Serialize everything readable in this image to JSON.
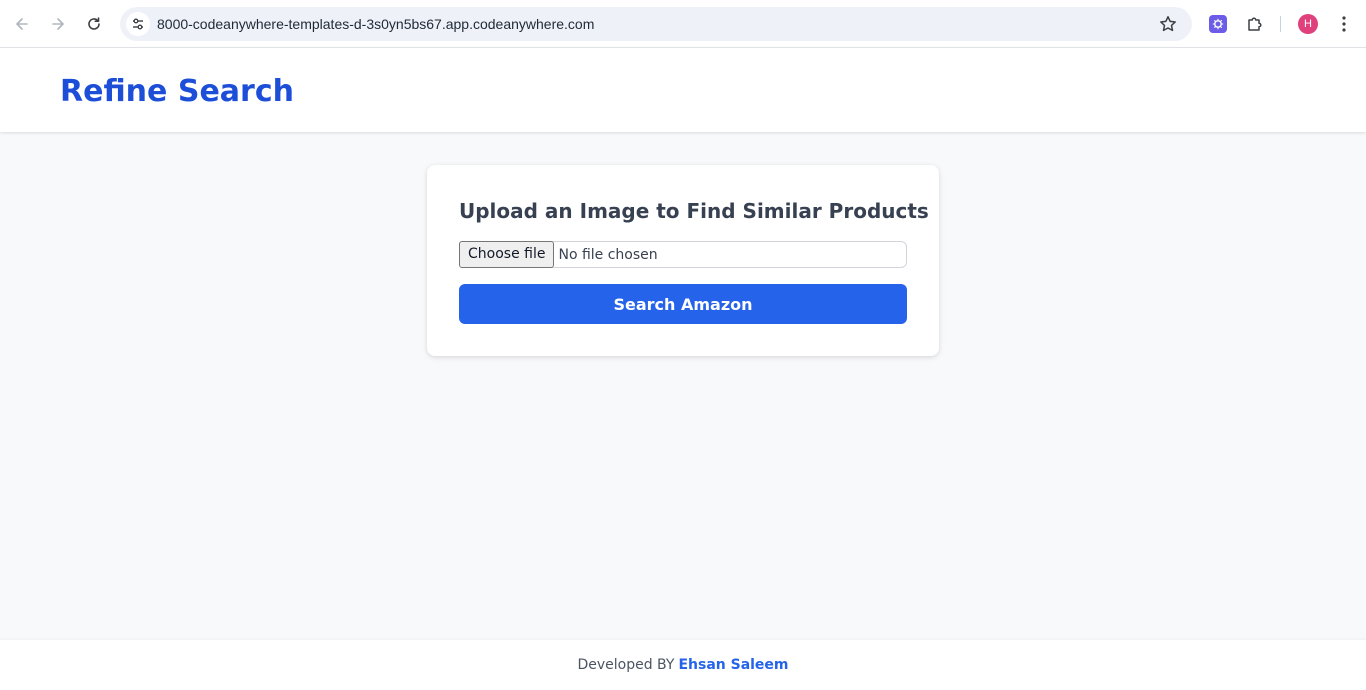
{
  "browser": {
    "url": "8000-codeanywhere-templates-d-3s0yn5bs67.app.codeanywhere.com",
    "avatar_initial": "H",
    "icons": [
      "back-icon",
      "forward-icon",
      "reload-icon",
      "site-info-icon",
      "star-icon",
      "ai-extension-icon",
      "puzzle-icon",
      "kebab-menu-icon"
    ]
  },
  "header": {
    "title": "Refine Search"
  },
  "card": {
    "heading": "Upload an Image to Find Similar Products",
    "file_button": "Choose file",
    "file_status": "No file chosen",
    "submit_label": "Search Amazon"
  },
  "footer": {
    "prefix": "Developed BY",
    "author": "Ehsan Saleem"
  },
  "colors": {
    "accent": "#2563eb",
    "title": "#1d4ed8",
    "avatar": "#e0417c"
  }
}
